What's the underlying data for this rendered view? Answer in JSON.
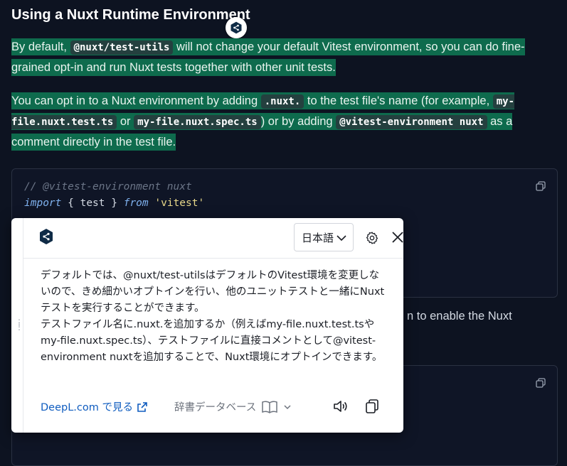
{
  "page": {
    "heading": "Using a Nuxt Runtime Environment",
    "para1": {
      "before": "By default, ",
      "code1": "@nuxt/test-utils",
      "after": " will not change your default Vitest environment, so you can do fine-grained opt-in and run Nuxt tests together with other unit tests."
    },
    "para2": {
      "t1": "You can opt in to a Nuxt environment by adding ",
      "code1": ".nuxt.",
      "t2": " to the test file's name (for example, ",
      "code2": "my-file.nuxt.test.ts",
      "t3": " or ",
      "code3": "my-file.nuxt.spec.ts",
      "t4": ") or by adding ",
      "code4": "@vitest-environment nuxt",
      "t5": " as a comment directly in the test file."
    },
    "code_block": {
      "comment": "// @vitest-environment nuxt",
      "kw_import": "import",
      "brace_open": " { ",
      "ident": "test",
      "brace_close": " } ",
      "kw_from": "from",
      "string": "'vitest'"
    },
    "behind_text": "n to enable the Nuxt"
  },
  "popup": {
    "language": "日本語",
    "translation": "デフォルトでは、@nuxt/test-utilsはデフォルトのVitest環境を変更しないので、きめ細かいオプトインを行い、他のユニットテストと一緒にNuxtテストを実行することができます。\nテストファイル名に.nuxt.を追加するか（例えばmy-file.nuxt.test.tsやmy-file.nuxt.spec.ts）、テストファイルに直接コメントとして@vitest-environment nuxtを追加することで、Nuxt環境にオプトインできます。",
    "deepl_link": "DeepL.com で見る",
    "dictionary": "辞書データベース"
  },
  "colors": {
    "highlight": "#0e6b4d",
    "background": "#0d1321",
    "link": "#0f5cbf"
  }
}
